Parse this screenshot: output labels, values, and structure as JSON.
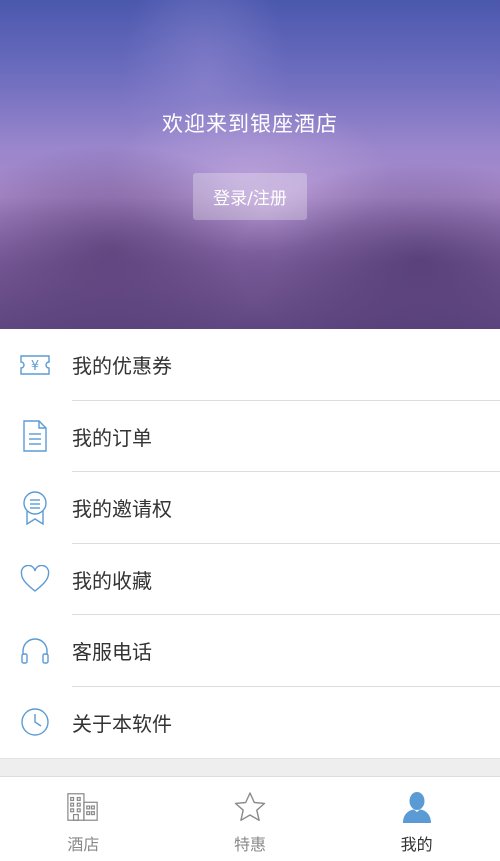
{
  "header": {
    "welcome": "欢迎来到银座酒店",
    "login_label": "登录/注册"
  },
  "menu": {
    "items": [
      {
        "label": "我的优惠券",
        "icon": "coupon-icon"
      },
      {
        "label": "我的订单",
        "icon": "document-icon"
      },
      {
        "label": "我的邀请权",
        "icon": "badge-icon"
      },
      {
        "label": "我的收藏",
        "icon": "heart-icon"
      },
      {
        "label": "客服电话",
        "icon": "headphones-icon"
      },
      {
        "label": "关于本软件",
        "icon": "clock-icon"
      }
    ]
  },
  "tabbar": {
    "tabs": [
      {
        "label": "酒店",
        "icon": "building-icon",
        "active": false
      },
      {
        "label": "特惠",
        "icon": "star-icon",
        "active": false
      },
      {
        "label": "我的",
        "icon": "person-icon",
        "active": true
      }
    ]
  },
  "colors": {
    "accent": "#5b9bd5",
    "tab_inactive": "#8a8a8a",
    "text": "#333333"
  }
}
